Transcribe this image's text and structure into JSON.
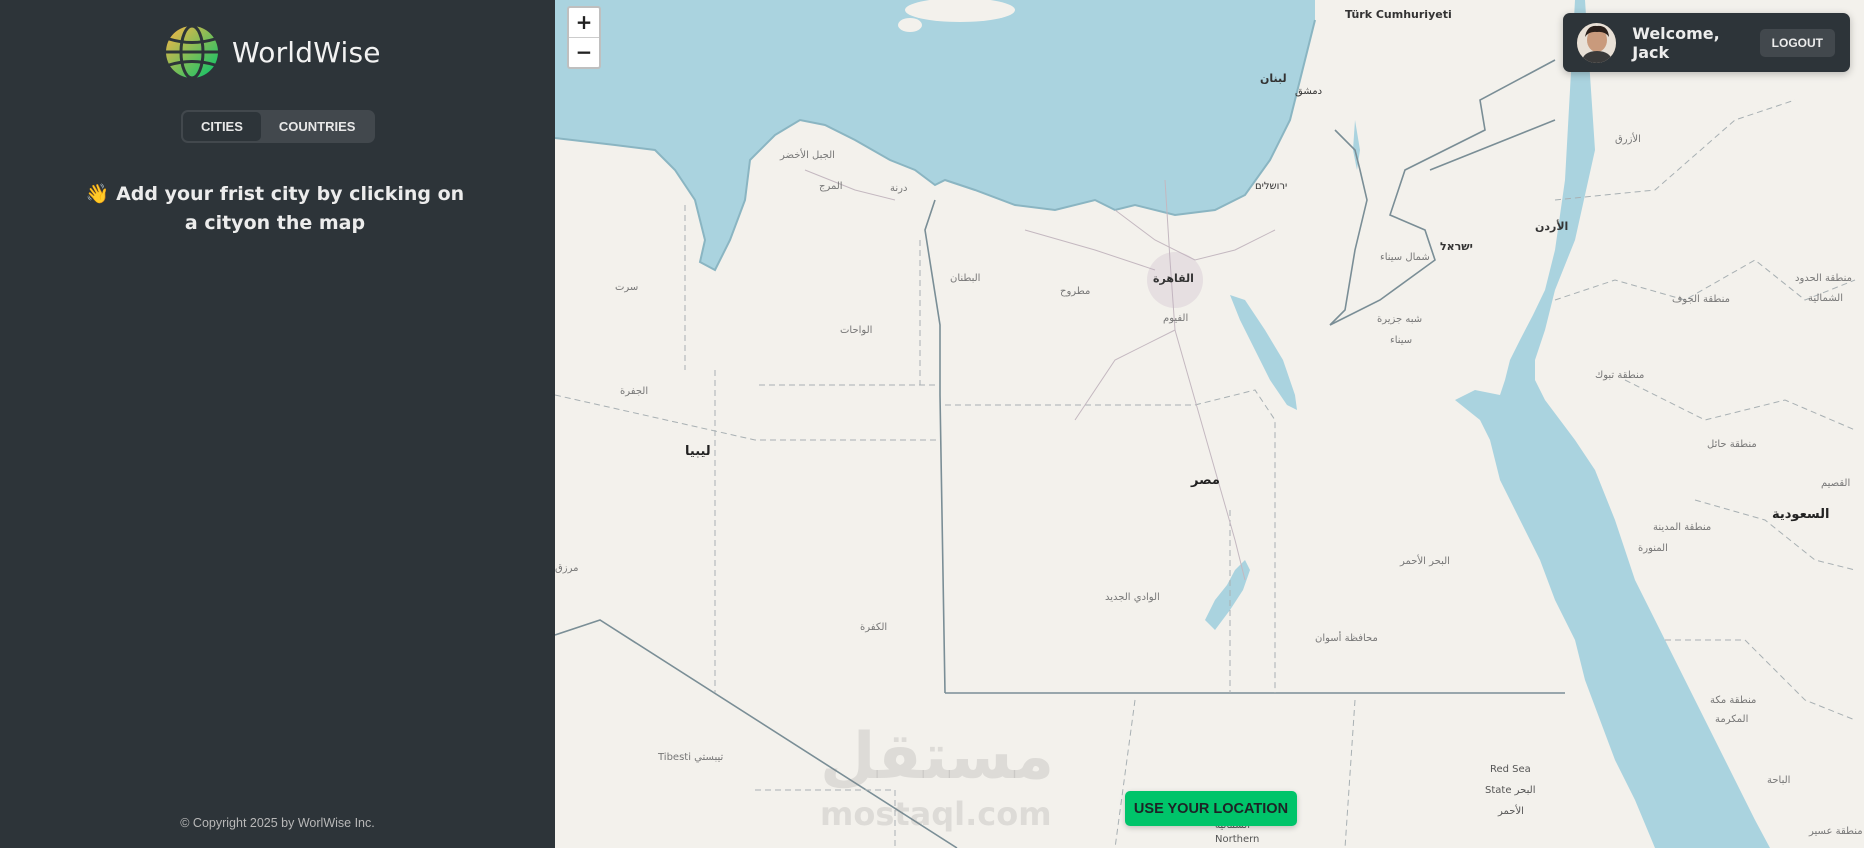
{
  "app": {
    "name": "WorldWise"
  },
  "tabs": [
    {
      "label": "CITIES",
      "active": true
    },
    {
      "label": "COUNTRIES",
      "active": false
    }
  ],
  "message": {
    "emoji": "👋",
    "text": "Add your frist city by clicking on a cityon the map"
  },
  "copyright": "© Copyright 2025 by WorlWise Inc.",
  "map": {
    "zoom_in": "+",
    "zoom_out": "−",
    "labels": {
      "turkey": "Türk Cumhuriyeti",
      "lebanon": "لبنان",
      "damascus": "دمشق",
      "jerusalem": "ירושלים",
      "israel": "ישראל",
      "jordan": "الأردن",
      "north_sinai": "شمال سيناء",
      "sinai_peninsula": "شبه جزيرة",
      "sinai": "سيناء",
      "cairo": "القاهرة",
      "faiyum": "الفيوم",
      "matrouh": "مطروح",
      "butnan": "البطنان",
      "jabal_akhdar": "الجبل الأخضر",
      "marj": "المرج",
      "derna": "درنة",
      "sirte": "سرت",
      "wahat": "الواحات",
      "jufra": "الجفرة",
      "libya": "ليبيا",
      "egypt": "مصر",
      "murzuq": "مرزق",
      "kufra": "الكفرة",
      "new_valley": "الوادي الجديد",
      "red_sea_gov": "البحر الأحمر",
      "aswan": "محافظة أسوان",
      "tibesti": "Tibesti تيبستي",
      "red_sea_state_1": "Red Sea",
      "red_sea_state_2": "State البحر",
      "red_sea_state_3": "الأحمر",
      "northern_1": "الشمالية",
      "northern_2": "Northern",
      "saudi": "السعودية",
      "tabuk": "منطقة تبوك",
      "jawf": "منطقة الجوف",
      "northern_borders_1": "منطقة الحدود",
      "northern_borders_2": "الشمالية",
      "hail": "منطقة حائل",
      "qassim": "القصيم",
      "madinah_1": "منطقة المدينة",
      "madinah_2": "المنورة",
      "makkah_1": "منطقة مكة",
      "makkah_2": "المكرمة",
      "baha": "الباحة",
      "asir": "منطقة عسير",
      "azraq": "الأزرق"
    },
    "watermark": {
      "arabic": "مستقل",
      "latin": "mostaql.com"
    }
  },
  "user": {
    "welcome": "Welcome, Jack",
    "logout": "LOGOUT"
  },
  "use_location": "USE YOUR LOCATION",
  "colors": {
    "sidebar": "#2d3439",
    "accent_green": "#00c46a",
    "sea": "#aad3df",
    "land": "#f3f1ec"
  }
}
